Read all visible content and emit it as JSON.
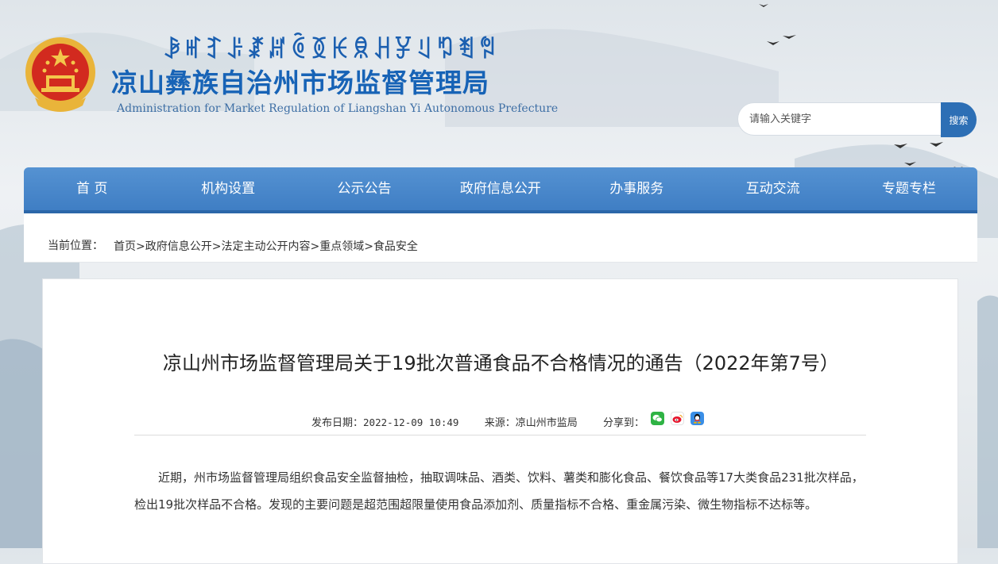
{
  "header": {
    "yi_name": "ꆃꎭꆈꌠꊨꏦꏱꅉꀘꌋꃅꐯꆹꑳꄮꅝ",
    "cn_name": "凉山彝族自治州市场监督管理局",
    "en_name": "Administration for Market Regulation of Liangshan Yi Autonomous Prefecture"
  },
  "search": {
    "placeholder": "请输入关键字",
    "button_label": "搜索"
  },
  "nav": {
    "items": [
      "首 页",
      "机构设置",
      "公示公告",
      "政府信息公开",
      "办事服务",
      "互动交流",
      "专题专栏"
    ]
  },
  "breadcrumb": {
    "label": "当前位置：",
    "items": [
      "首页",
      "政府信息公开",
      "法定主动公开内容",
      "重点领域",
      "食品安全"
    ],
    "separator": ">"
  },
  "article": {
    "title": "凉山州市场监督管理局关于19批次普通食品不合格情况的通告（2022年第7号）",
    "publish_label": "发布日期：",
    "publish_date": "2022-12-09 10:49",
    "source_label": "来源：",
    "source": "凉山州市监局",
    "share_label": "分享到：",
    "share_icons": [
      "wechat-icon",
      "weibo-icon",
      "qq-icon"
    ],
    "body": "近期，州市场监督管理局组织食品安全监督抽检，抽取调味品、酒类、饮料、薯类和膨化食品、餐饮食品等17大类食品231批次样品，检出19批次样品不合格。发现的主要问题是超范围超限量使用食品添加剂、质量指标不合格、重金属污染、微生物指标不达标等。"
  },
  "colors": {
    "brand_blue": "#1763b6",
    "nav_blue": "#4a88cb",
    "search_button": "#2d6fb5"
  }
}
